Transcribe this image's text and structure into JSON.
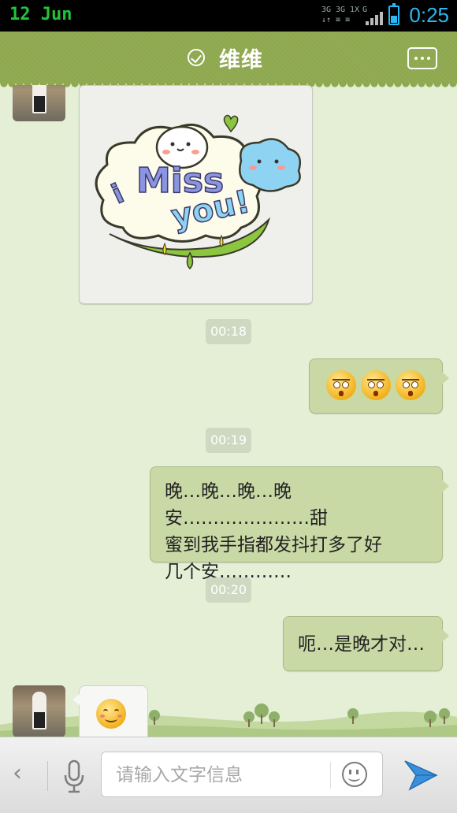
{
  "status_bar": {
    "date": "12 Jun",
    "network": [
      "3G",
      "3G 1X",
      "G"
    ],
    "time": "0:25"
  },
  "header": {
    "title": "维维",
    "icons": [
      "check-circle-icon",
      "more-menu-icon"
    ]
  },
  "messages": [
    {
      "type": "sticker",
      "direction": "in",
      "sticker_text": "i Miss you!"
    },
    {
      "type": "timestamp",
      "text": "00:18"
    },
    {
      "type": "emoji",
      "direction": "out",
      "emojis": [
        "angry-face-emoji",
        "angry-face-emoji",
        "angry-face-emoji"
      ]
    },
    {
      "type": "timestamp",
      "text": "00:19"
    },
    {
      "type": "text",
      "direction": "out",
      "lines": [
        "晚…晚…晚…晚安…………………甜",
        "蜜到我手指都发抖打多了好",
        "几个安…………"
      ]
    },
    {
      "type": "timestamp",
      "text": "00:20"
    },
    {
      "type": "text",
      "direction": "out",
      "text": "呃…是晚才对…"
    },
    {
      "type": "emoji",
      "direction": "in",
      "emojis": [
        "smile-face-emoji"
      ]
    }
  ],
  "input_bar": {
    "placeholder": "请输入文字信息",
    "icons": [
      "back-chevron-icon",
      "microphone-icon",
      "emoji-face-icon",
      "send-plane-icon"
    ]
  },
  "colors": {
    "header": "#8ea84e",
    "chat_background": "#e4efd6",
    "outgoing_bubble": "#c9d9a6",
    "incoming_bubble": "#f7f7f5",
    "send_button": "#3a8fd8"
  }
}
